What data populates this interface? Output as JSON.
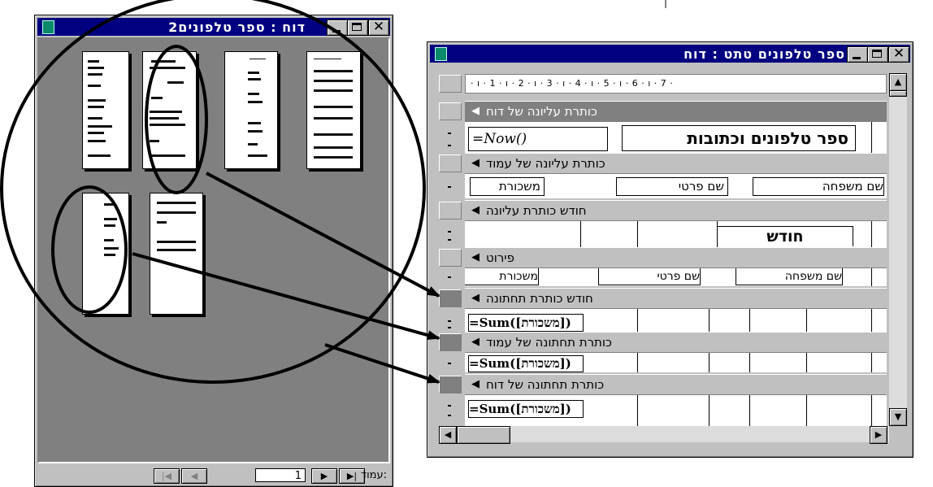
{
  "top_char": "|",
  "preview_window": {
    "title": "דוח : ספר טלפונים2",
    "page_label": "עמוד:",
    "page_value": "1",
    "nav": {
      "first": "|◀",
      "prev": "◀",
      "next": "▶",
      "last": "▶|"
    }
  },
  "design_window": {
    "title": "ספר טלפונים טתט : דוח",
    "ruler_text": "· ı · 1 · ı · 2 · ı · 3 · ı · 4 · ı · 5 · ı · 6 · ı · 7 ·",
    "sections": [
      {
        "label": "כותרת עליונה של דוח"
      },
      {
        "label": "כותרת עליונה של עמוד"
      },
      {
        "label": "חודש כותרת עליונה"
      },
      {
        "label": "פירוט"
      },
      {
        "label": "חודש כותרת תחתונה"
      },
      {
        "label": "כותרת תחתונה של עמוד"
      },
      {
        "label": "כותרת תחתונה של דוח"
      }
    ],
    "report_header": {
      "title": "ספר טלפונים וכתובות",
      "now": "=Now()"
    },
    "page_header": {
      "last_name": "שם משפחה",
      "first_name": "שם פרטי",
      "salary": "משכורת"
    },
    "month_header": {
      "month": "חודש"
    },
    "detail": {
      "last_name": "שם משפחה",
      "first_name": "שם פרטי",
      "salary": "משכורת"
    },
    "sum_prefix": "=Sum(",
    "sum_field": "[משכורת]",
    "sum_suffix": ")"
  },
  "colors": {
    "titlebar": "#000080",
    "window": "#c0c0c0",
    "workspace": "#808080"
  }
}
